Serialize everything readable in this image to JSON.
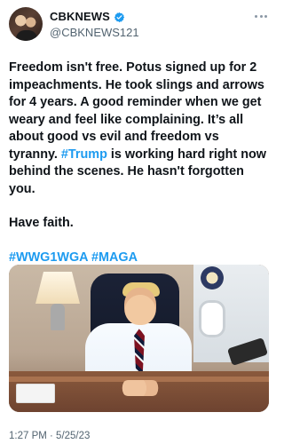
{
  "tweet": {
    "author": {
      "display_name": "CBKNEWS",
      "handle": "@CBKNEWS121",
      "verified": true
    },
    "text": {
      "para1_prefix": "Freedom isn't free. Potus signed up for 2 impeachments. He took slings and arrows for 4 years. A good reminder when we get weary and feel like complaining. It’s all about good vs evil and freedom vs tyranny. ",
      "para1_hashtag": "#Trump",
      "para1_suffix": " is working hard right now behind the scenes. He hasn't forgotten you.",
      "para2": "Have faith.",
      "hashtags_line": "#WWG1WGA #MAGA"
    },
    "timestamp": "1:27 PM · 5/25/23"
  },
  "ui": {
    "accent_color": "#1d9bf0",
    "icons": {
      "verified": "verified-badge-icon",
      "more": "more-options-icon"
    }
  }
}
